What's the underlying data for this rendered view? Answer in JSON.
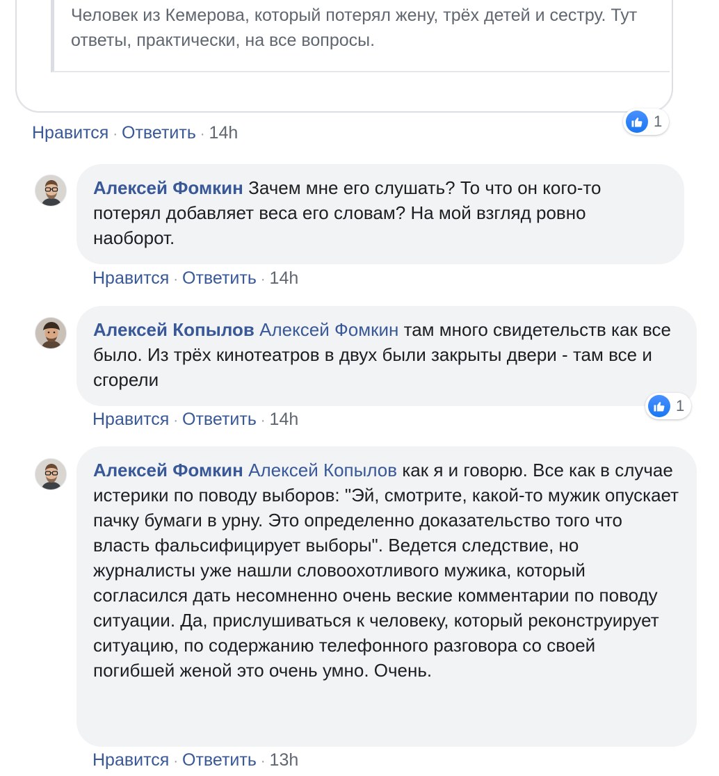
{
  "top_post": {
    "quote": "Человек из Кемерова, который потерял жену, трёх детей и сестру. Тут ответы, практически, на все вопросы.",
    "like_label": "Нравится",
    "reply_label": "Ответить",
    "time": "14h",
    "reaction_count": "1"
  },
  "comments": [
    {
      "author": "Алексей Фомкин",
      "mention": "",
      "text": "Зачем мне его слушать? То что он кого-то потерял добавляет веса его словам? На мой взгляд ровно наоборот.",
      "like_label": "Нравится",
      "reply_label": "Ответить",
      "time": "14h"
    },
    {
      "author": "Алексей Копылов",
      "mention": "Алексей Фомкин",
      "text": "там много свидетельств как все было. Из трёх кинотеатров в двух были закрыты двери - там все и сгорели",
      "like_label": "Нравится",
      "reply_label": "Ответить",
      "time": "14h",
      "reaction_count": "1"
    },
    {
      "author": "Алексей Фомкин",
      "mention": "Алексей Копылов",
      "text": "как я и говорю. Все как в случае истерики по поводу выборов: \"Эй, смотрите, какой-то мужик опускает пачку бумаги в урну. Это определенно доказательство того что власть фальсифицирует выборы\". Ведется следствие, но журналисты уже нашли словоохотливого мужика, который согласился дать несомненно очень веские комментарии по поводу ситуации. Да, прислушиваться к человеку, который реконструирует ситуацию, по содержанию телефонного разговора со своей погибшей женой это очень умно. Очень.",
      "like_label": "Нравится",
      "reply_label": "Ответить",
      "time": "13h"
    }
  ],
  "separator": "·",
  "colors": {
    "link": "#385898",
    "bubble_bg": "#f2f3f5",
    "meta_gray": "#606770",
    "like_blue": "#1877f2"
  },
  "icons": {
    "like": "thumbs-up-icon",
    "avatar": "user-avatar"
  }
}
